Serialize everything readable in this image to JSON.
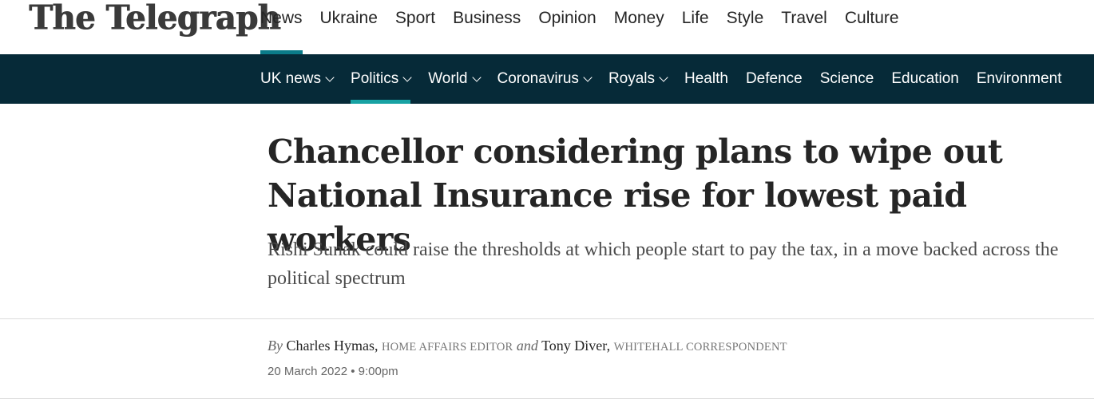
{
  "masthead": {
    "logo": "The Telegraph",
    "nav": [
      {
        "label": "News",
        "active": true
      },
      {
        "label": "Ukraine"
      },
      {
        "label": "Sport"
      },
      {
        "label": "Business"
      },
      {
        "label": "Opinion"
      },
      {
        "label": "Money"
      },
      {
        "label": "Life"
      },
      {
        "label": "Style"
      },
      {
        "label": "Travel"
      },
      {
        "label": "Culture"
      }
    ]
  },
  "subnav": {
    "items": [
      {
        "label": "UK news",
        "dropdown": true
      },
      {
        "label": "Politics",
        "dropdown": true,
        "active": true
      },
      {
        "label": "World",
        "dropdown": true
      },
      {
        "label": "Coronavirus",
        "dropdown": true
      },
      {
        "label": "Royals",
        "dropdown": true
      },
      {
        "label": "Health"
      },
      {
        "label": "Defence"
      },
      {
        "label": "Science"
      },
      {
        "label": "Education"
      },
      {
        "label": "Environment"
      }
    ]
  },
  "article": {
    "headline": "Chancellor considering plans to wipe out National Insurance rise for lowest paid workers",
    "standfirst": "Rishi Sunak could raise the thresholds at which people start to pay the tax, in a move backed across the political spectrum",
    "byline": {
      "by": "By",
      "author1": "Charles Hymas,",
      "role1": "HOME AFFAIRS EDITOR",
      "and": "and",
      "author2": "Tony Diver,",
      "role2": "WHITEHALL CORRESPONDENT"
    },
    "date": "20 March 2022 • 9:00pm"
  },
  "colors": {
    "subnav_bg": "#062a38",
    "accent": "#0b7c8a"
  }
}
